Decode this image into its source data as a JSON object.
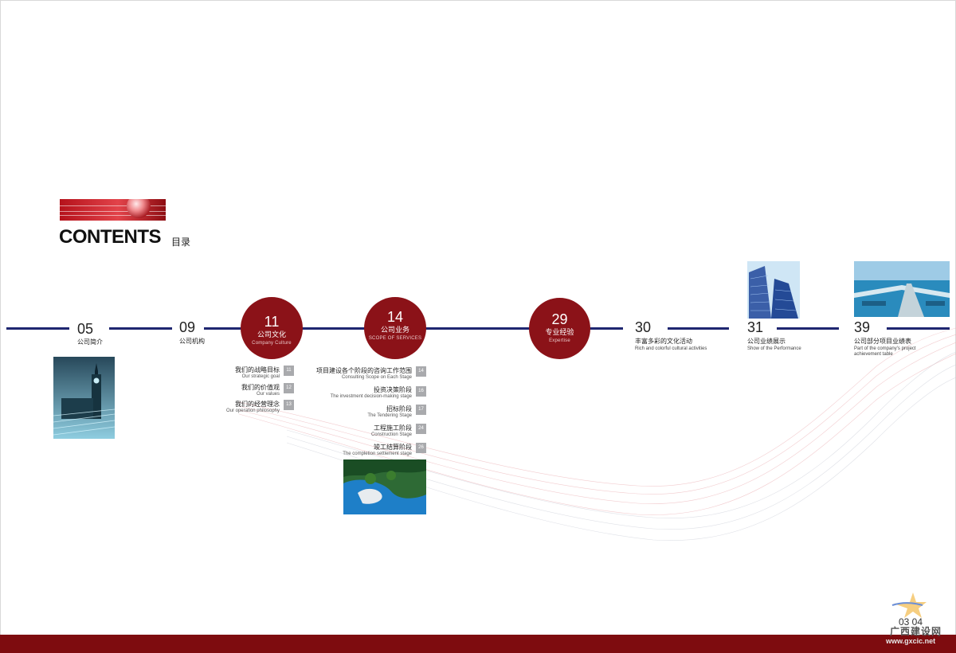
{
  "header": {
    "title": "CONTENTS",
    "title_cn": "目录"
  },
  "timeline": [
    {
      "num": "05",
      "cn": "公司简介",
      "en": ""
    },
    {
      "num": "09",
      "cn": "公司机构",
      "en": ""
    },
    {
      "num": "11",
      "cn": "公司文化",
      "en": "Company Culture"
    },
    {
      "num": "14",
      "cn": "公司业务",
      "en": "SCOPE OF SERVICES"
    },
    {
      "num": "29",
      "cn": "专业经验",
      "en": "Expertise"
    },
    {
      "num": "30",
      "cn": "丰富多彩的文化活动",
      "en": "Rich and colorful cultural activities"
    },
    {
      "num": "31",
      "cn": "公司业绩展示",
      "en": "Show of the Performance"
    },
    {
      "num": "39",
      "cn": "公司部分项目业绩表",
      "en": "Part of the company’s project achievement table"
    }
  ],
  "culture_items": [
    {
      "cn": "我们的战略目标",
      "en": "Our strategic goal",
      "page": "11"
    },
    {
      "cn": "我们的价值观",
      "en": "Our values",
      "page": "12"
    },
    {
      "cn": "我们的经营理念",
      "en": "Our operation philosophy",
      "page": "13"
    }
  ],
  "service_items": [
    {
      "cn": "项目建设各个阶段的咨询工作范围",
      "en": "Consulting Scope on Each Stage",
      "page": "14"
    },
    {
      "cn": "投资决策阶段",
      "en": "The investment decision-making stage",
      "page": "16"
    },
    {
      "cn": "招标阶段",
      "en": "The Tendering Stage",
      "page": "17"
    },
    {
      "cn": "工程施工阶段",
      "en": "Construction Stage",
      "page": "24"
    },
    {
      "cn": "竣工结算阶段",
      "en": "The completion settlement stage",
      "page": "26"
    }
  ],
  "footer": {
    "page_numbers": "03 04",
    "watermark_cn": "广西建设网",
    "watermark_url": "www.gxcic.net"
  },
  "colors": {
    "primary_red": "#8b1218",
    "timeline_blue": "#1f2670",
    "bottom_bar": "#7e0c0f"
  }
}
